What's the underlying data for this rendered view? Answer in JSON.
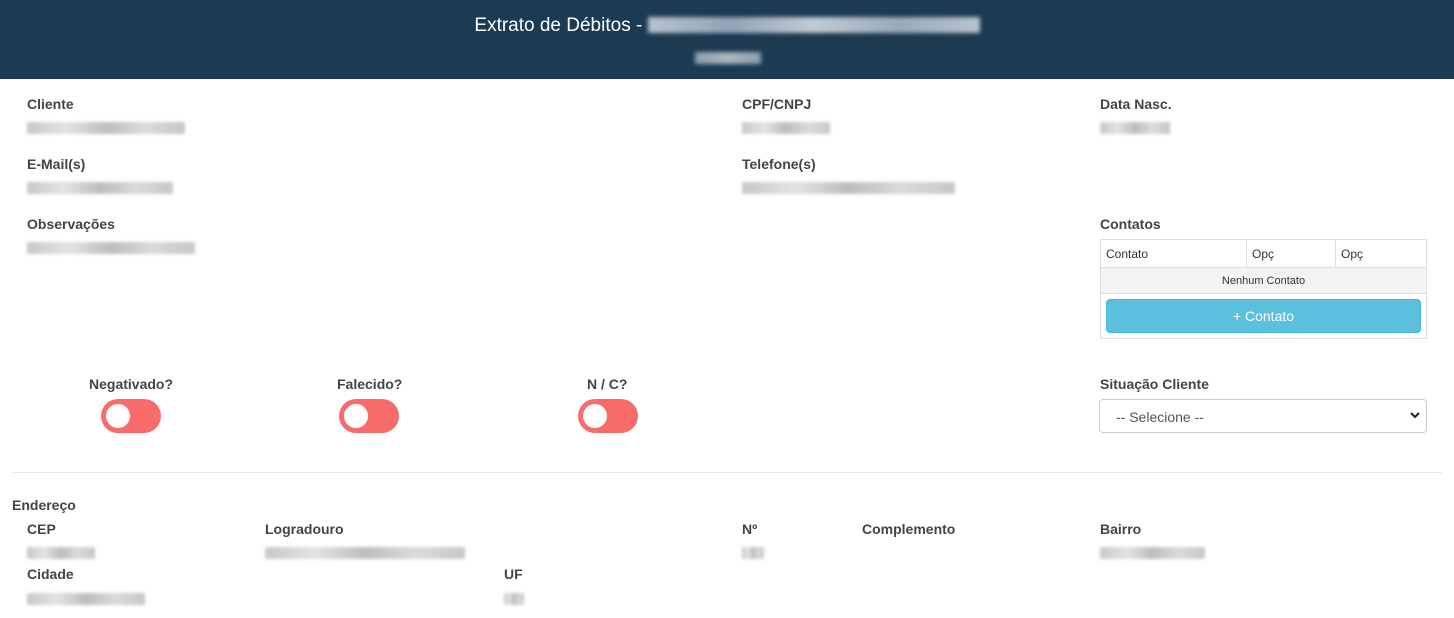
{
  "header": {
    "title_prefix": "Extrato de Débitos -"
  },
  "fields": {
    "cliente": {
      "label": "Cliente"
    },
    "cpf": {
      "label": "CPF/CNPJ"
    },
    "data_nasc": {
      "label": "Data Nasc."
    },
    "email": {
      "label": "E-Mail(s)"
    },
    "telefone": {
      "label": "Telefone(s)"
    },
    "observacoes": {
      "label": "Observações"
    }
  },
  "contacts": {
    "label": "Contatos",
    "columns": [
      "Contato",
      "Opç",
      "Opç"
    ],
    "empty_text": "Nenhum Contato",
    "add_button": "+ Contato"
  },
  "toggles": [
    {
      "label": "Negativado?",
      "on": false
    },
    {
      "label": "Falecido?",
      "on": false
    },
    {
      "label": "N / C?",
      "on": false
    }
  ],
  "situacao": {
    "label": "Situação Cliente",
    "selected": "-- Selecione --"
  },
  "address": {
    "section_label": "Endereço",
    "cep": "CEP",
    "logradouro": "Logradouro",
    "numero": "Nº",
    "complemento": "Complemento",
    "bairro": "Bairro",
    "cidade": "Cidade",
    "uf": "UF"
  },
  "colors": {
    "header_bg": "#1c3a52",
    "toggle_off": "#f76b6b",
    "button_info": "#5bc0de"
  }
}
